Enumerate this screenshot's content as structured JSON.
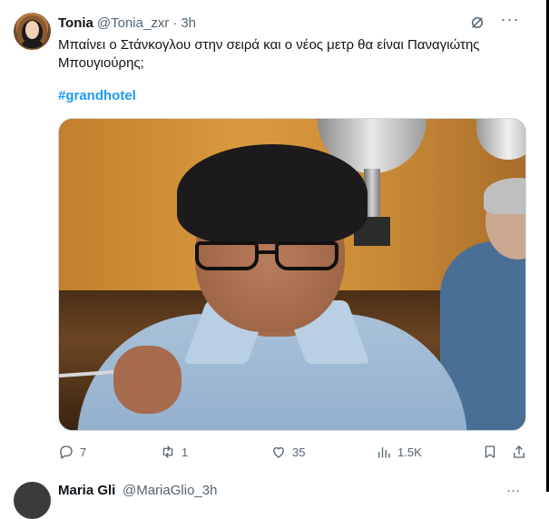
{
  "tweet": {
    "author_name": "Tonia",
    "author_handle": "@Tonia_zxr",
    "separator": "·",
    "time": "3h",
    "text": "Μπαίνει ο Στάνκογλου στην σειρά και ο νέος μετρ θα είναι Παναγιώτης Μπουγιούρης;",
    "hashtag": "#grandhotel",
    "more_label": "···",
    "actions": {
      "replies": "7",
      "retweets": "1",
      "likes": "35",
      "views": "1.5K"
    }
  },
  "next_tweet": {
    "author_name": "Maria Gli",
    "author_handle": "@MariaGlio_3h",
    "right_glyph": "···"
  },
  "icons": {
    "top_right": [
      "grok-icon",
      "more-icon"
    ],
    "actions": [
      "reply-icon",
      "retweet-icon",
      "like-icon",
      "views-icon",
      "bookmark-icon",
      "share-icon"
    ]
  },
  "colors": {
    "accent": "#1d9bf0",
    "text_primary": "#0f1419",
    "text_secondary": "#536471",
    "border": "#cfd9de"
  }
}
